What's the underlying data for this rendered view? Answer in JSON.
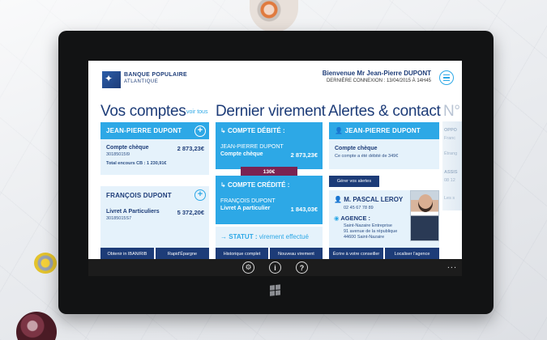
{
  "header": {
    "bank_name": "BANQUE POPULAIRE",
    "bank_sub": "ATLANTIQUE",
    "welcome": "Bienvenue Mr Jean-Pierre DUPONT",
    "last_connection": "DERNIÈRE CONNEXION : 13/04/2015 À 14H45"
  },
  "sections": {
    "accounts_title": "Vos comptes",
    "see_all": "voir tous",
    "transfer_title": "Dernier virement",
    "alerts_title": "Alertes & contact",
    "next_title": "N°"
  },
  "accounts": {
    "owner1": "JEAN-PIERRE DUPONT",
    "acc1_label": "Compte chèque",
    "acc1_number": "30185015I9",
    "acc1_amount": "2 873,23€",
    "acc1_cb": "Total encours CB : 1 230,91€",
    "owner2": "FRANÇOIS DUPONT",
    "acc2_label": "Livret A Particuliers",
    "acc2_number": "30185015S7",
    "acc2_amount": "5 372,20€",
    "btn_iban": "Obtenir in IBAN/RIB",
    "btn_savings": "Rapid'Épargne"
  },
  "transfer": {
    "debit_title": "COMPTE DÉBITÉ :",
    "debit_name": "JEAN-PIERRE DUPONT",
    "debit_account": "Compte chèque",
    "debit_amount": "2 873,23€",
    "amount_badge": "130€",
    "credit_title": "COMPTE CRÉDITÉ :",
    "credit_name": "FRANÇOIS DUPONT",
    "credit_account": "Livret A particulier",
    "credit_amount": "1 843,03€",
    "status_label": "STATUT :",
    "status_value": "virement effectué",
    "btn_history": "Historique complet",
    "btn_new": "Nouveau virement"
  },
  "alerts": {
    "owner": "JEAN-PIERRE DUPONT",
    "account": "Compte chèque",
    "alert_text": "Ce compte a été débité de 349€",
    "btn_manage": "Gérer vos alertes",
    "advisor_name": "M. PASCAL LEROY",
    "advisor_phone": "02 45 67 78 89",
    "agency_label": "AGENCE :",
    "agency_line1": "Saint-Nazaire Entreprise",
    "agency_line2": "91 avenue de la république",
    "agency_line3": "44600 Saint-Nazaire",
    "btn_write": "Écrire à votre conseiller",
    "btn_locate": "Localiser l'agence"
  },
  "peek": {
    "l1": "OPPO",
    "l2": "Franc",
    "l3": "Étrang",
    "l4": "ASSIS",
    "l5": "08 12 ",
    "l6": "Les s"
  },
  "appbar": {
    "settings": "⚙",
    "info": "i",
    "help": "?",
    "more": "..."
  },
  "colors": {
    "brand_navy": "#1d3c78",
    "accent_blue": "#2da8e6",
    "card_bg": "#e5f2fb",
    "badge_purple": "#7a2352"
  }
}
